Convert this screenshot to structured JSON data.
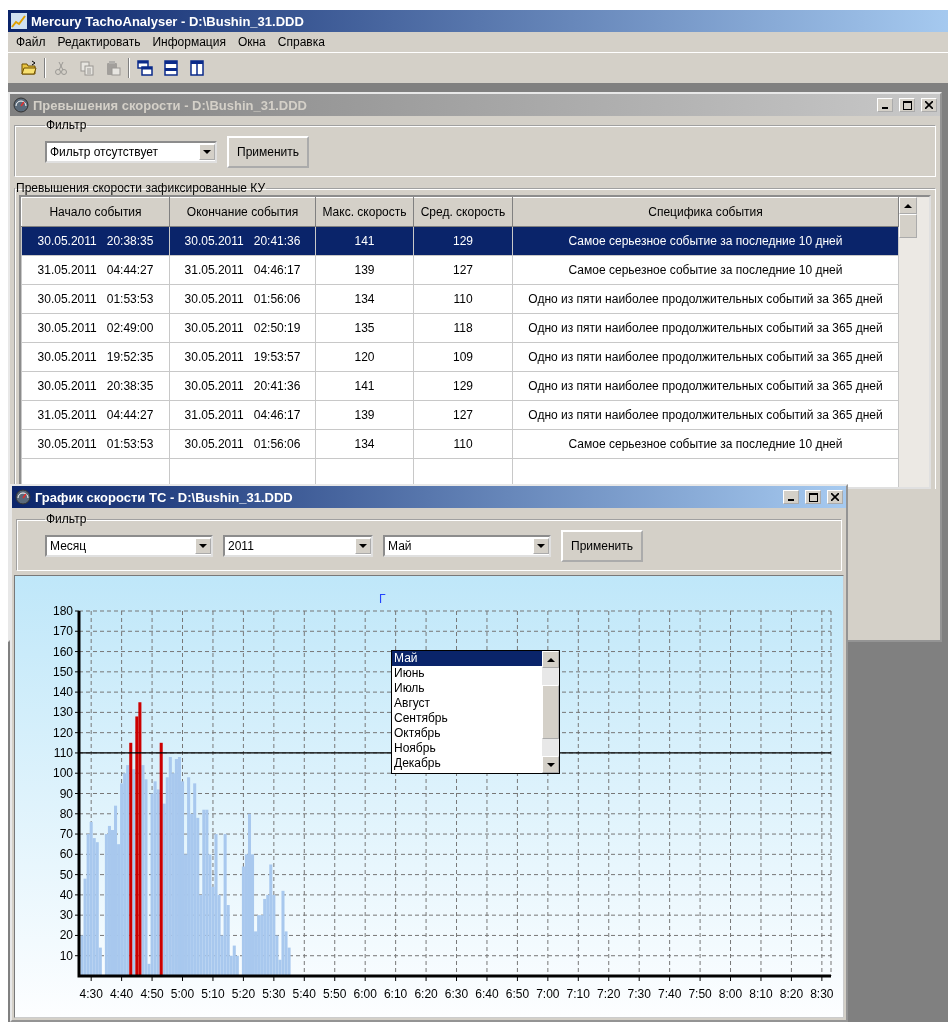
{
  "app": {
    "title": "Mercury TachoAnalyser - D:\\Bushin_31.DDD",
    "menu": [
      "Файл",
      "Редактировать",
      "Информация",
      "Окна",
      "Справка"
    ],
    "toolbar": [
      {
        "kind": "open",
        "disabled": false
      },
      {
        "kind": "separator"
      },
      {
        "kind": "cut",
        "disabled": true
      },
      {
        "kind": "copy",
        "disabled": true
      },
      {
        "kind": "paste",
        "disabled": true
      },
      {
        "kind": "separator"
      },
      {
        "kind": "cascade",
        "disabled": false
      },
      {
        "kind": "tile-horizontal",
        "disabled": false
      },
      {
        "kind": "tile-vertical",
        "disabled": false
      }
    ]
  },
  "speeding_window": {
    "title": "Превышения скорости - D:\\Bushin_31.DDD",
    "active": false,
    "filter": {
      "label": "Фильтр",
      "value": "Фильтр отсутствует",
      "button": "Применить"
    },
    "group_label": "Превышения скорости зафиксированные КУ",
    "table": {
      "columns": [
        "Начало события",
        "Окончание события",
        "Макс. скорость",
        "Сред. скорость",
        "Специфика события"
      ],
      "rows": [
        {
          "selected": true,
          "cells": [
            "30.05.2011   20:38:35",
            "30.05.2011   20:41:36",
            "141",
            "129",
            "Самое серьезное событие за последние 10 дней"
          ]
        },
        {
          "selected": false,
          "cells": [
            "31.05.2011   04:44:27",
            "31.05.2011   04:46:17",
            "139",
            "127",
            "Самое серьезное событие за последние 10 дней"
          ]
        },
        {
          "selected": false,
          "cells": [
            "30.05.2011   01:53:53",
            "30.05.2011   01:56:06",
            "134",
            "110",
            "Одно из пяти наиболее продолжительных событий за 365 дней"
          ]
        },
        {
          "selected": false,
          "cells": [
            "30.05.2011   02:49:00",
            "30.05.2011   02:50:19",
            "135",
            "118",
            "Одно из пяти наиболее продолжительных событий за 365 дней"
          ]
        },
        {
          "selected": false,
          "cells": [
            "30.05.2011   19:52:35",
            "30.05.2011   19:53:57",
            "120",
            "109",
            "Одно из пяти наиболее продолжительных событий за 365 дней"
          ]
        },
        {
          "selected": false,
          "cells": [
            "30.05.2011   20:38:35",
            "30.05.2011   20:41:36",
            "141",
            "129",
            "Одно из пяти наиболее продолжительных событий за 365 дней"
          ]
        },
        {
          "selected": false,
          "cells": [
            "31.05.2011   04:44:27",
            "31.05.2011   04:46:17",
            "139",
            "127",
            "Одно из пяти наиболее продолжительных событий за 365 дней"
          ]
        },
        {
          "selected": false,
          "cells": [
            "30.05.2011   01:53:53",
            "30.05.2011   01:56:06",
            "134",
            "110",
            "Самое серьезное событие за последние 10 дней"
          ]
        }
      ]
    }
  },
  "chart_window": {
    "title": "График скорости ТС - D:\\Bushin_31.DDD",
    "active": true,
    "filter": {
      "label": "Фильтр",
      "selects": [
        "Месяц",
        "2011",
        "Май"
      ],
      "button": "Применить"
    },
    "dropdown": {
      "items": [
        {
          "label": "Май",
          "selected": true
        },
        {
          "label": "Июнь",
          "selected": false
        },
        {
          "label": "Июль",
          "selected": false
        },
        {
          "label": "Август",
          "selected": false
        },
        {
          "label": "Сентябрь",
          "selected": false
        },
        {
          "label": "Октябрь",
          "selected": false
        },
        {
          "label": "Ноябрь",
          "selected": false
        },
        {
          "label": "Декабрь",
          "selected": false
        }
      ]
    },
    "chart_title": "Г",
    "chart_data": {
      "type": "bar",
      "grid": true,
      "xlim": [
        266,
        513
      ],
      "ylim": [
        0,
        180
      ],
      "yticks": [
        10,
        20,
        30,
        40,
        50,
        60,
        70,
        80,
        90,
        100,
        110,
        120,
        130,
        140,
        150,
        160,
        170,
        180
      ],
      "xticks": [
        {
          "value": 270,
          "label": "4:30"
        },
        {
          "value": 280,
          "label": "4:40"
        },
        {
          "value": 290,
          "label": "4:50"
        },
        {
          "value": 300,
          "label": "5:00"
        },
        {
          "value": 310,
          "label": "5:10"
        },
        {
          "value": 320,
          "label": "5:20"
        },
        {
          "value": 330,
          "label": "5:30"
        },
        {
          "value": 340,
          "label": "5:40"
        },
        {
          "value": 350,
          "label": "5:50"
        },
        {
          "value": 360,
          "label": "6:00"
        },
        {
          "value": 370,
          "label": "6:10"
        },
        {
          "value": 380,
          "label": "6:20"
        },
        {
          "value": 390,
          "label": "6:30"
        },
        {
          "value": 400,
          "label": "6:40"
        },
        {
          "value": 410,
          "label": "6:50"
        },
        {
          "value": 420,
          "label": "7:00"
        },
        {
          "value": 430,
          "label": "7:10"
        },
        {
          "value": 440,
          "label": "7:20"
        },
        {
          "value": 450,
          "label": "7:30"
        },
        {
          "value": 460,
          "label": "7:40"
        },
        {
          "value": 470,
          "label": "7:50"
        },
        {
          "value": 480,
          "label": "8:00"
        },
        {
          "value": 490,
          "label": "8:10"
        },
        {
          "value": 500,
          "label": "8:20"
        },
        {
          "value": 510,
          "label": "8:30"
        }
      ],
      "x": [
        267,
        268,
        269,
        270,
        271,
        272,
        273,
        274,
        275,
        276,
        277,
        278,
        279,
        280,
        281,
        282,
        283,
        284,
        285,
        286,
        287,
        288,
        289,
        290,
        291,
        292,
        293,
        294,
        295,
        296,
        297,
        298,
        299,
        300,
        301,
        302,
        303,
        304,
        305,
        306,
        307,
        308,
        309,
        310,
        311,
        312,
        313,
        314,
        315,
        316,
        317,
        318,
        319,
        320,
        321,
        322,
        323,
        324,
        325,
        326,
        327,
        328,
        329,
        330,
        331,
        332,
        333,
        334,
        335
      ],
      "series": [
        {
          "color": "#a8c8ee",
          "values": [
            20,
            48,
            70,
            76,
            68,
            66,
            14,
            0,
            70,
            74,
            72,
            84,
            65,
            95,
            100,
            104,
            null,
            102,
            null,
            null,
            104,
            97,
            6,
            90,
            96,
            92,
            null,
            85,
            98,
            108,
            100,
            107,
            108,
            96,
            60,
            98,
            80,
            95,
            78,
            40,
            82,
            82,
            60,
            44,
            70,
            40,
            20,
            70,
            35,
            10,
            15,
            10,
            0,
            54,
            60,
            80,
            60,
            22,
            30,
            30,
            38,
            40,
            55,
            40,
            20,
            8,
            42,
            22,
            14
          ]
        },
        {
          "color": "#cc0000",
          "values": [
            null,
            null,
            null,
            null,
            null,
            null,
            null,
            null,
            null,
            null,
            null,
            null,
            null,
            null,
            null,
            null,
            115,
            null,
            128,
            135,
            null,
            null,
            null,
            null,
            null,
            null,
            115,
            null,
            null,
            null,
            null,
            null,
            null,
            null,
            null,
            null,
            null,
            null,
            null,
            null,
            null,
            null,
            null,
            null,
            null,
            null,
            null,
            null,
            null,
            null,
            null,
            null,
            null,
            null,
            null,
            null,
            null,
            null,
            null,
            null,
            null,
            null,
            null,
            null,
            null,
            null,
            null,
            null,
            null
          ]
        }
      ],
      "ref_lines": [
        {
          "axis": "y",
          "value": 110
        }
      ]
    }
  }
}
